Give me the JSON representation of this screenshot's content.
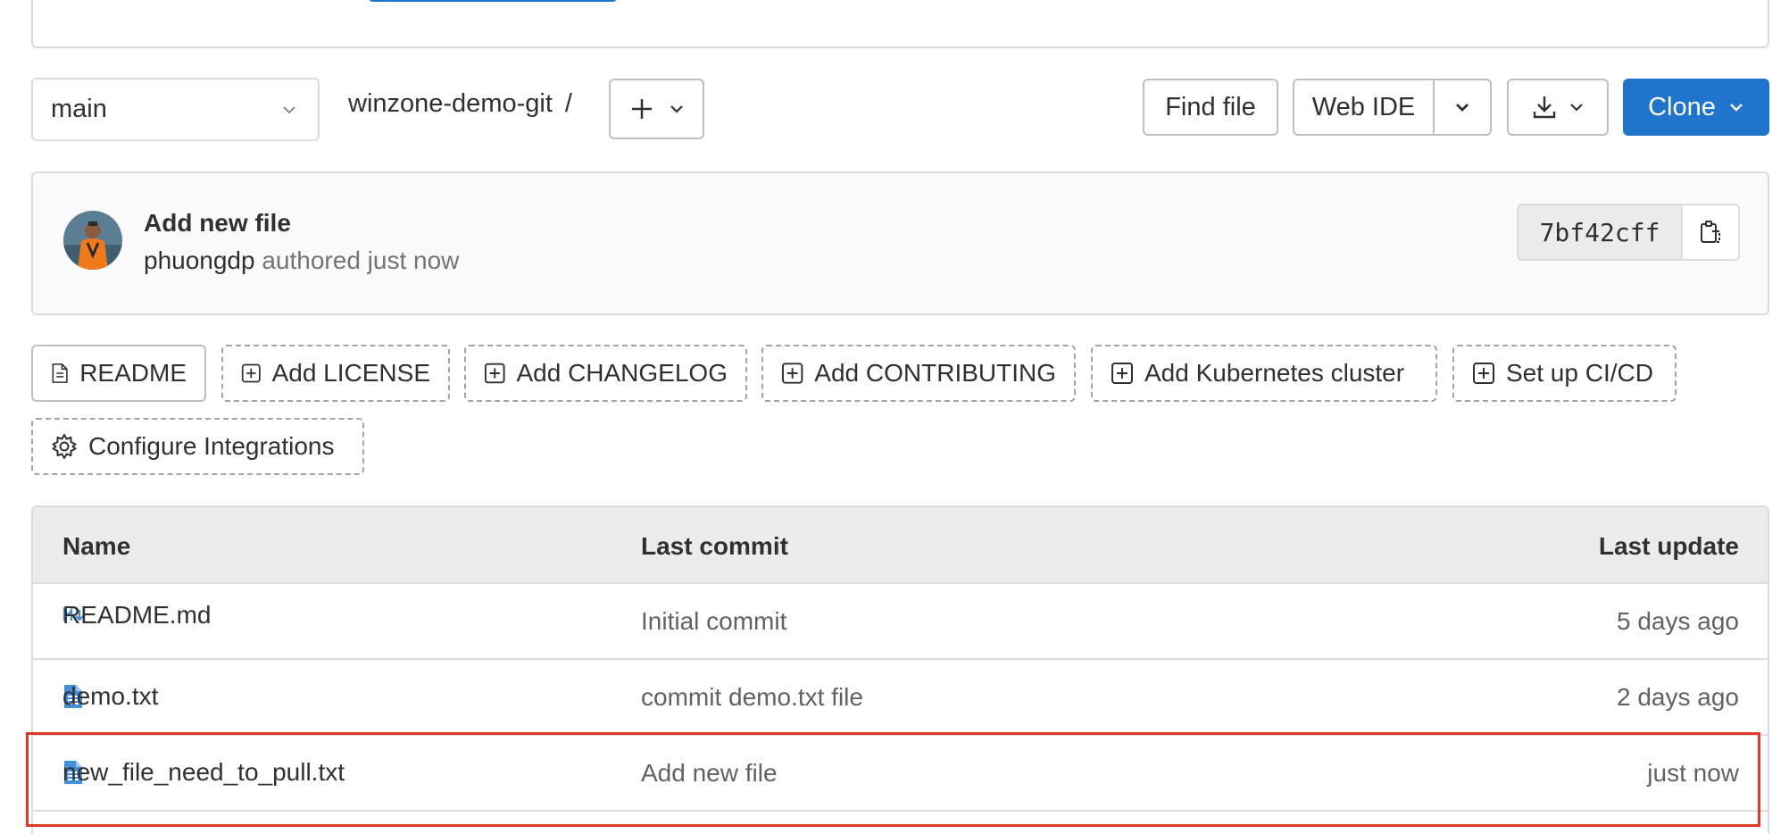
{
  "toolbar": {
    "branch": "main",
    "project": "winzone-demo-git",
    "separator": "/",
    "find_file": "Find file",
    "web_ide": "Web IDE",
    "clone": "Clone"
  },
  "commit": {
    "title": "Add new file",
    "author": "phuongdp",
    "meta": "authored just now",
    "sha": "7bf42cff"
  },
  "quick_actions": [
    {
      "label": "README",
      "icon": "file-icon"
    },
    {
      "label": "Add LICENSE",
      "icon": "plus-square-icon"
    },
    {
      "label": "Add CHANGELOG",
      "icon": "plus-square-icon"
    },
    {
      "label": "Add CONTRIBUTING",
      "icon": "plus-square-icon"
    },
    {
      "label": "Add Kubernetes cluster",
      "icon": "plus-square-icon"
    },
    {
      "label": "Set up CI/CD",
      "icon": "plus-square-icon"
    },
    {
      "label": "Configure Integrations",
      "icon": "gear-icon"
    }
  ],
  "table": {
    "headers": {
      "name": "Name",
      "last_commit": "Last commit",
      "last_update": "Last update"
    },
    "rows": [
      {
        "name": "README.md",
        "icon": "markdown-icon",
        "commit": "Initial commit",
        "updated": "5 days ago"
      },
      {
        "name": "demo.txt",
        "icon": "text-file-icon",
        "commit": "commit demo.txt file",
        "updated": "2 days ago"
      },
      {
        "name": "new_file_need_to_pull.txt",
        "icon": "text-file-icon",
        "commit": "Add new file",
        "updated": "just now"
      }
    ]
  },
  "colors": {
    "primary": "#1f75cb",
    "highlight": "#e0382b",
    "file_icon": "#428fdc"
  }
}
